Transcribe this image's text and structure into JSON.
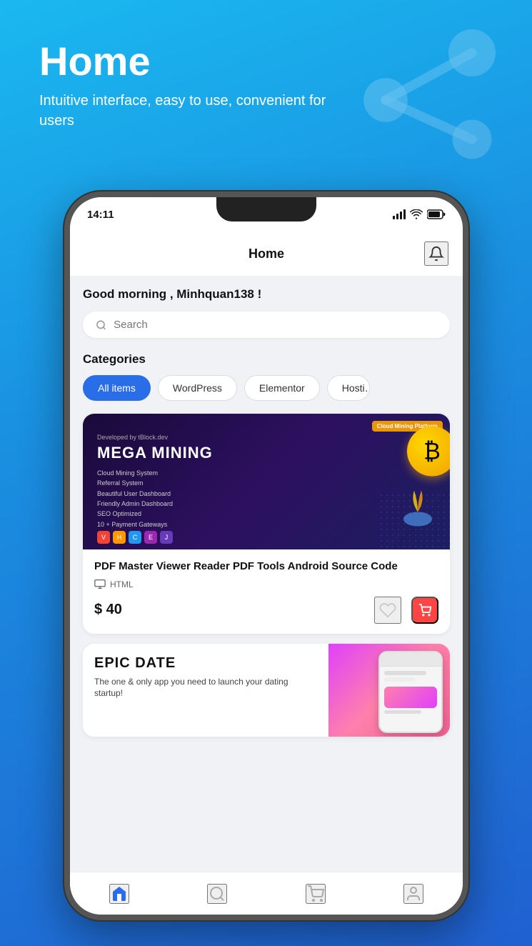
{
  "background": {
    "gradient_start": "#1ab8f0",
    "gradient_end": "#2060d0"
  },
  "page_header": {
    "title": "Home",
    "subtitle": "Intuitive interface, easy to use, convenient for users"
  },
  "status_bar": {
    "time": "14:11",
    "signal": "▌▌▌",
    "wifi": "wifi",
    "battery": "battery"
  },
  "app_header": {
    "title": "Home",
    "bell_label": "bell"
  },
  "greeting": "Good morning , Minhquan138 !",
  "search": {
    "placeholder": "Search"
  },
  "categories": {
    "section_title": "Categories",
    "items": [
      {
        "label": "All items",
        "active": true
      },
      {
        "label": "WordPress",
        "active": false
      },
      {
        "label": "Elementor",
        "active": false
      },
      {
        "label": "Hosti…",
        "active": false,
        "partial": true
      }
    ]
  },
  "products": [
    {
      "image_title_small": "Developed by tBlock.dev",
      "image_badge": "Cloud Mining Platform",
      "image_main_title": "MEGA MINING",
      "features": [
        "Cloud Mining System",
        "Referral System",
        "Beautiful User Dashboard",
        "Friendly Admin Dashboard",
        "SEO Optimized",
        "10 + Payment Gateways"
      ],
      "name": "PDF Master Viewer Reader PDF Tools Android Source Code",
      "type": "HTML",
      "price": "$ 40",
      "heart_label": "♡",
      "cart_label": "🛒"
    }
  ],
  "second_product": {
    "title": "EPIC  DATE",
    "description": "The one & only app you need to launch your dating startup!"
  },
  "bottom_nav": {
    "items": [
      {
        "icon": "🏠",
        "active": true,
        "label": "home"
      },
      {
        "icon": "🔍",
        "active": false,
        "label": "search"
      },
      {
        "icon": "🛒",
        "active": false,
        "label": "cart"
      },
      {
        "icon": "👤",
        "active": false,
        "label": "profile"
      }
    ]
  }
}
